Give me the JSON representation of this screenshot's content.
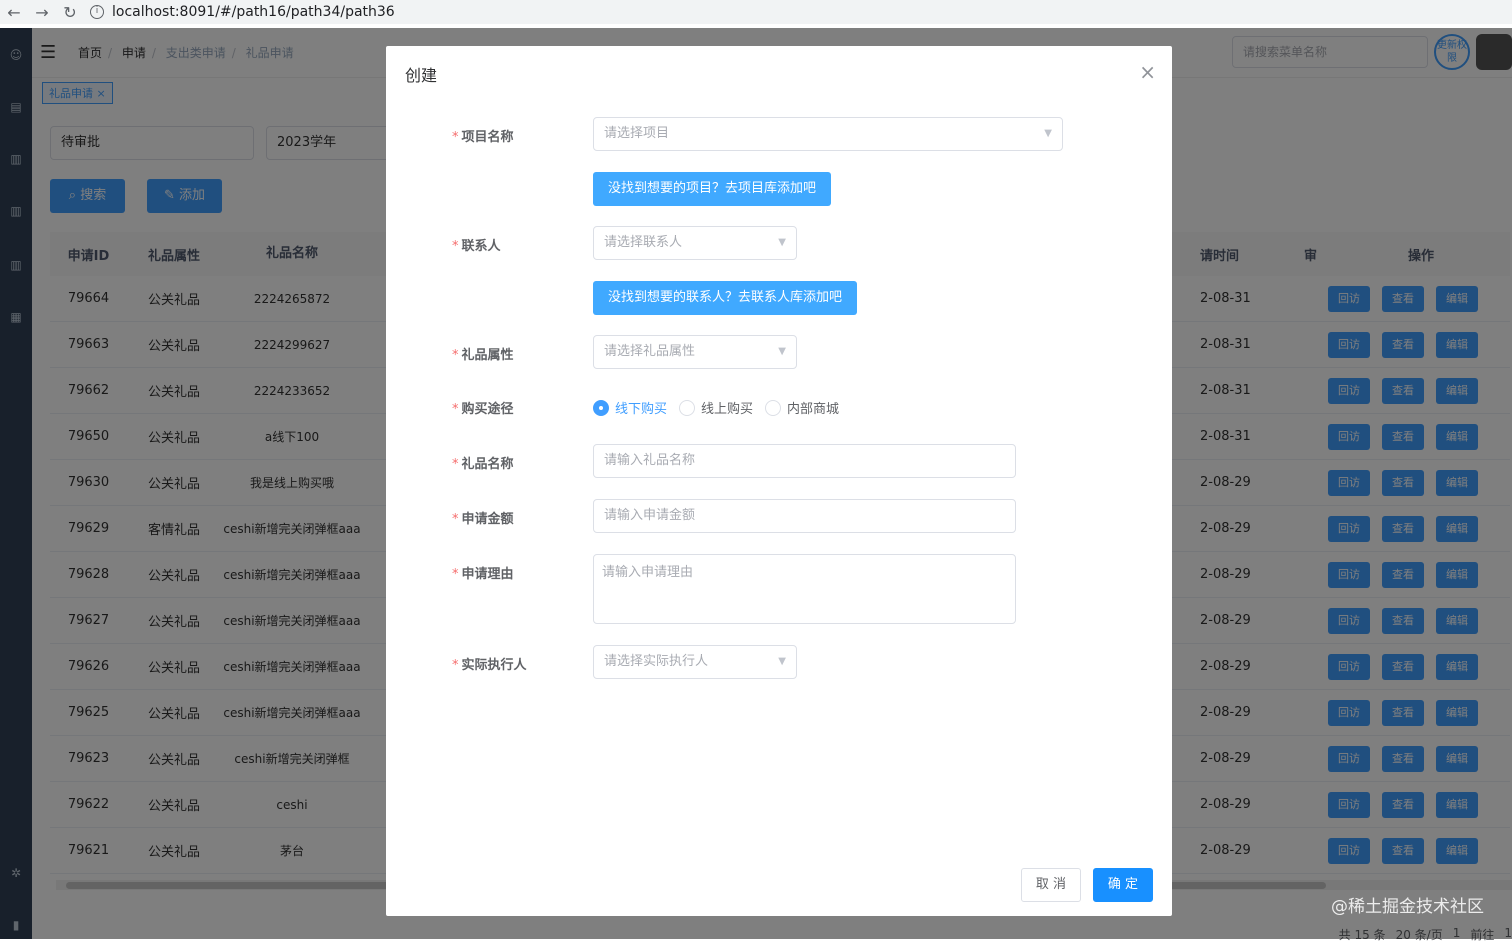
{
  "browser": {
    "url": "localhost:8091/#/path16/path34/path36"
  },
  "topnav": {
    "breadcrumb": [
      "首页",
      "申请",
      "支出类申请",
      "礼品申请"
    ],
    "menu_search_placeholder": "请搜索菜单名称",
    "update_label": "更新权限"
  },
  "tags": [
    {
      "label": "礼品申请",
      "close": "×"
    }
  ],
  "filters": {
    "status": "待审批",
    "year": "2023学年"
  },
  "actions": {
    "search": "搜索",
    "add": "添加"
  },
  "table": {
    "headers": [
      "申请ID",
      "礼品属性",
      "礼品名称",
      "请时间",
      "审",
      "操作"
    ],
    "rows": [
      {
        "id": "79664",
        "attr": "公关礼品",
        "name": "2224265872",
        "date": "2-08-31"
      },
      {
        "id": "79663",
        "attr": "公关礼品",
        "name": "2224299627",
        "date": "2-08-31"
      },
      {
        "id": "79662",
        "attr": "公关礼品",
        "name": "2224233652",
        "date": "2-08-31"
      },
      {
        "id": "79650",
        "attr": "公关礼品",
        "name": "a线下100",
        "date": "2-08-31"
      },
      {
        "id": "79630",
        "attr": "公关礼品",
        "name": "我是线上购买哦",
        "date": "2-08-29"
      },
      {
        "id": "79629",
        "attr": "客情礼品",
        "name": "ceshi新增完关闭弹框aaa",
        "date": "2-08-29"
      },
      {
        "id": "79628",
        "attr": "公关礼品",
        "name": "ceshi新增完关闭弹框aaa",
        "date": "2-08-29"
      },
      {
        "id": "79627",
        "attr": "公关礼品",
        "name": "ceshi新增完关闭弹框aaa",
        "date": "2-08-29"
      },
      {
        "id": "79626",
        "attr": "公关礼品",
        "name": "ceshi新增完关闭弹框aaa",
        "date": "2-08-29"
      },
      {
        "id": "79625",
        "attr": "公关礼品",
        "name": "ceshi新增完关闭弹框aaa",
        "date": "2-08-29"
      },
      {
        "id": "79623",
        "attr": "公关礼品",
        "name": "ceshi新增完关闭弹框",
        "date": "2-08-29"
      },
      {
        "id": "79622",
        "attr": "公关礼品",
        "name": "ceshi",
        "date": "2-08-29"
      },
      {
        "id": "79621",
        "attr": "公关礼品",
        "name": "茅台",
        "date": "2-08-29"
      }
    ],
    "ops": [
      "回访",
      "查看",
      "编辑"
    ]
  },
  "pagination": {
    "total": "共 15 条",
    "page_size": "20 条/页",
    "current": "1",
    "goto": "前往",
    "goto_value": "1"
  },
  "watermark": "@稀土掘金技术社区",
  "dialog": {
    "title": "创建",
    "close": "×",
    "fields": {
      "project": {
        "label": "项目名称",
        "placeholder": "请选择项目"
      },
      "project_link": "没找到想要的项目？去项目库添加吧",
      "contact": {
        "label": "联系人",
        "placeholder": "请选择联系人"
      },
      "contact_link": "没找到想要的联系人？去联系人库添加吧",
      "gift_attr": {
        "label": "礼品属性",
        "placeholder": "请选择礼品属性"
      },
      "purchase": {
        "label": "购买途径",
        "options": [
          "线下购买",
          "线上购买",
          "内部商城"
        ],
        "selected": "线下购买"
      },
      "gift_name": {
        "label": "礼品名称",
        "placeholder": "请输入礼品名称"
      },
      "amount": {
        "label": "申请金额",
        "placeholder": "请输入申请金额"
      },
      "reason": {
        "label": "申请理由",
        "placeholder": "请输入申请理由"
      },
      "executor": {
        "label": "实际执行人",
        "placeholder": "请选择实际执行人"
      }
    },
    "cancel": "取 消",
    "confirm": "确 定"
  }
}
